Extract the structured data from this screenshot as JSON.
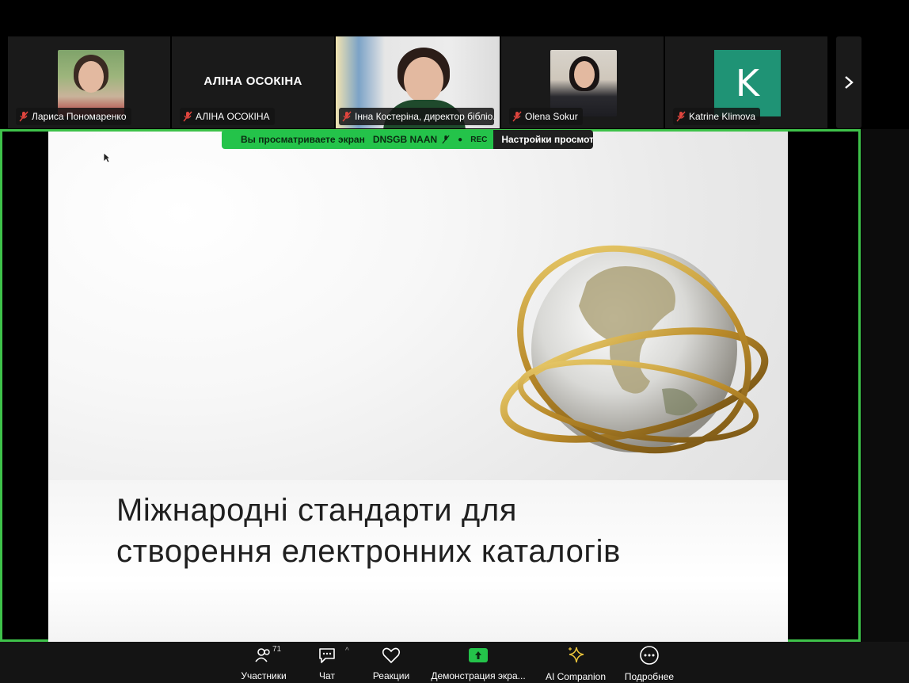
{
  "participants": [
    {
      "name": "Лариса Пономаренко",
      "muted": true
    },
    {
      "name": "АЛІНА ОСОКІНА",
      "display_name": "АЛІНА ОСОКІНА",
      "muted": true
    },
    {
      "name": "Інна Костеріна, директор бібліо...",
      "muted": true
    },
    {
      "name": "Olena Sokur",
      "muted": true
    },
    {
      "name": "Katrine Klimova",
      "initial": "K",
      "muted": true
    }
  ],
  "share_banner": {
    "viewing_label": "Вы просматриваете экран",
    "host": "DNSGB NAAN",
    "rec_label": "REC",
    "view_options": "Настройки просмотра"
  },
  "slide": {
    "title_line1": "Міжнародні стандарти для",
    "title_line2": "створення електронних каталогів"
  },
  "toolbar": {
    "participants_label": "Участники",
    "participants_count": "71",
    "chat_label": "Чат",
    "reactions_label": "Реакции",
    "share_label": "Демонстрация экра...",
    "ai_label": "AI Companion",
    "more_label": "Подробнее"
  },
  "colors": {
    "share_green": "#24c34a",
    "frame_green": "#3ec24a",
    "muted_red": "#e0453e",
    "avatar_teal": "#1f9375"
  },
  "icons": [
    "muted-mic-icon",
    "chevron-right-icon",
    "participants-icon",
    "chat-icon",
    "reactions-icon",
    "share-screen-icon",
    "ai-companion-icon",
    "more-icon",
    "record-icon"
  ]
}
